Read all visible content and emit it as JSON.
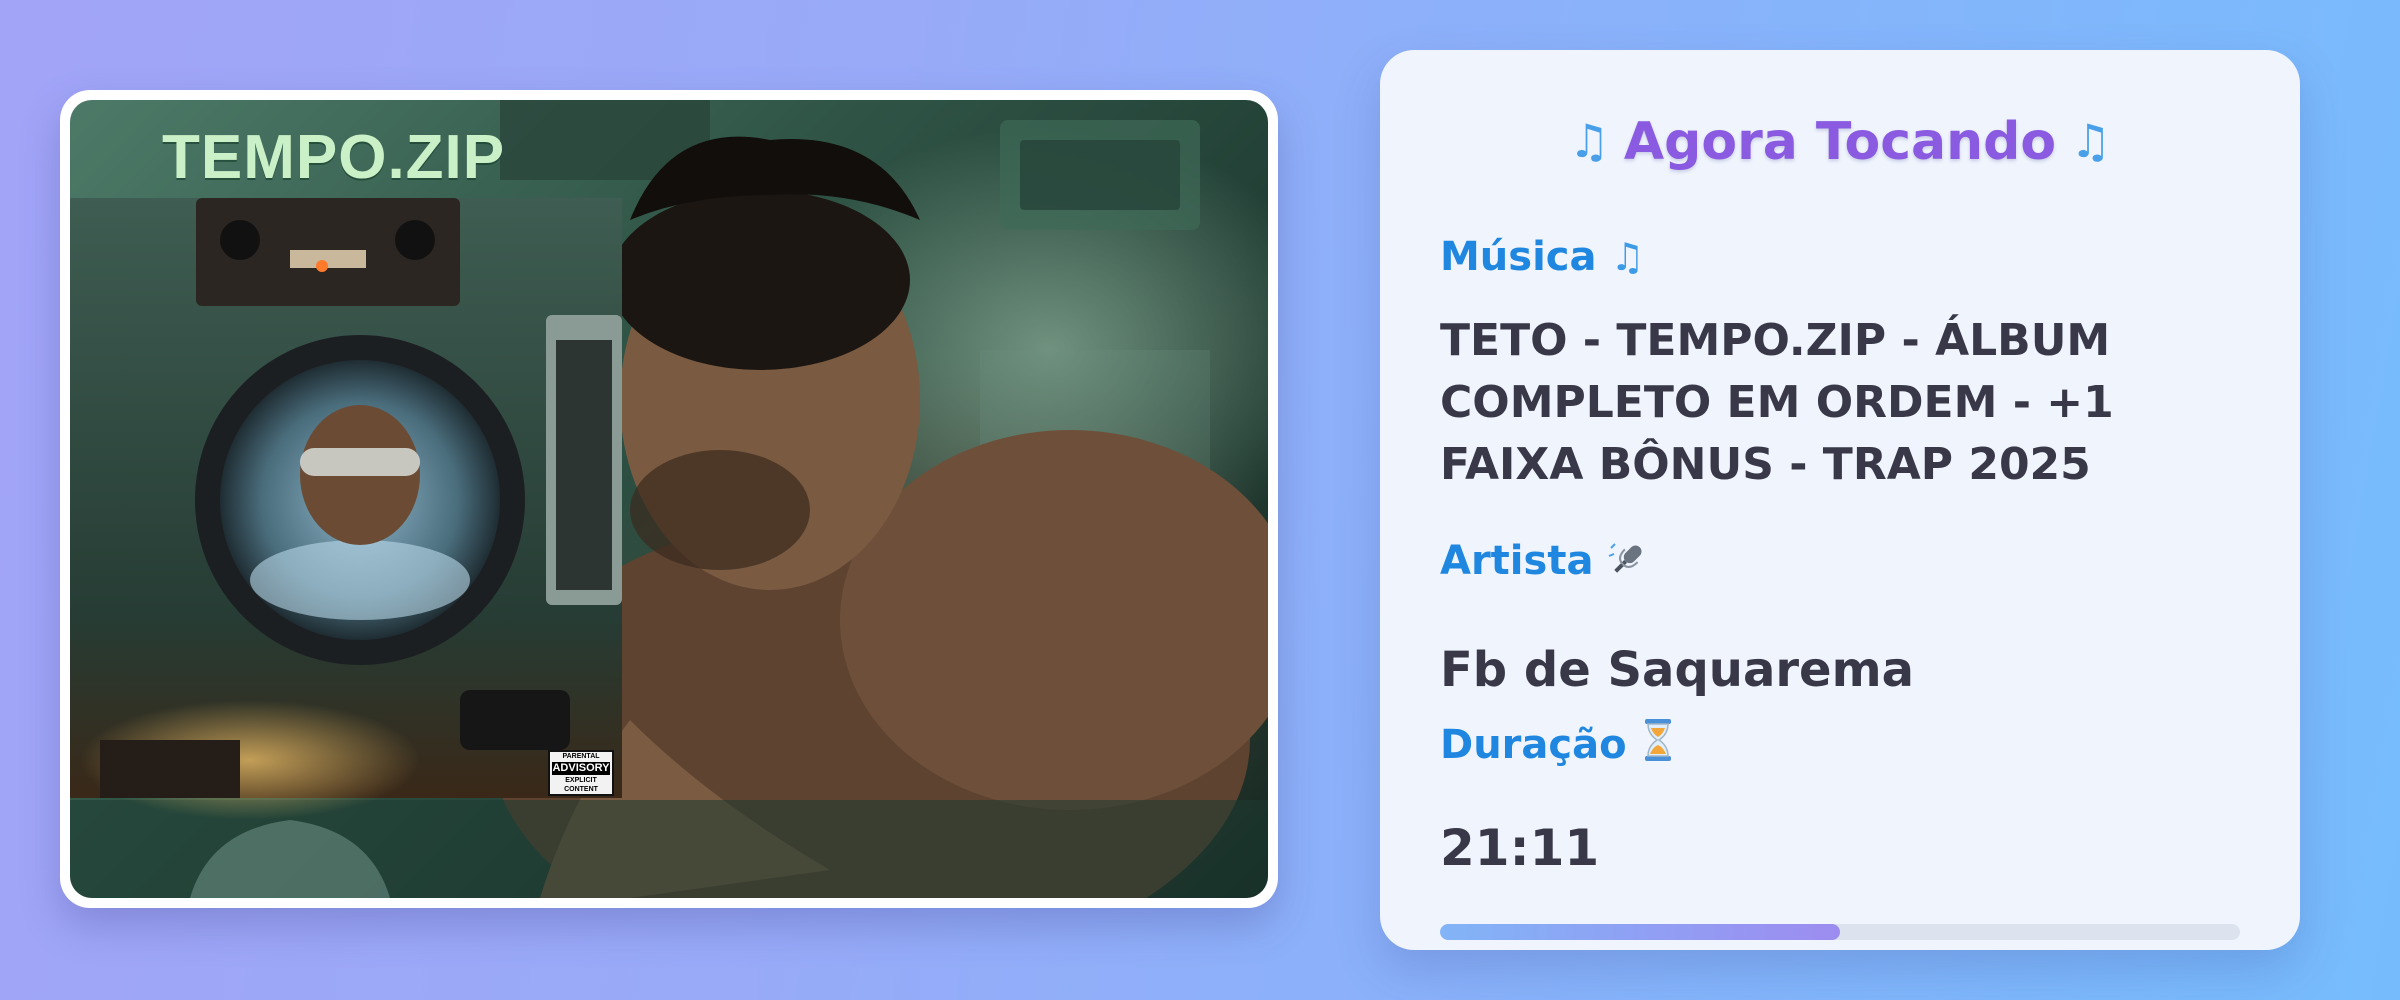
{
  "thumbnail": {
    "album_title": "TEMPO.ZIP",
    "advisory_top": "PARENTAL",
    "advisory_main": "ADVISORY",
    "advisory_bottom": "EXPLICIT CONTENT"
  },
  "panel": {
    "title": "Agora Tocando",
    "title_icon": "music-notes-icon",
    "song": {
      "label": "Música",
      "icon": "music-note-icon",
      "value": "TETO - TEMPO.ZIP - ÁLBUM COMPLETO EM ORDEM - +1 FAIXA BÔNUS - TRAP 2025"
    },
    "artist": {
      "label": "Artista",
      "icon": "microphone-icon",
      "value": "Fb de Saquarema"
    },
    "duration": {
      "label": "Duração",
      "icon": "hourglass-icon",
      "value": "21:11"
    },
    "progress": 0.5
  },
  "colors": {
    "title": "#8a5be0",
    "label": "#1f87e0",
    "value": "#383848",
    "panel_bg": "#eff4fd",
    "progress_start": "#82b4f7",
    "progress_end": "#9d8cf0",
    "track": "#dde3ee"
  }
}
